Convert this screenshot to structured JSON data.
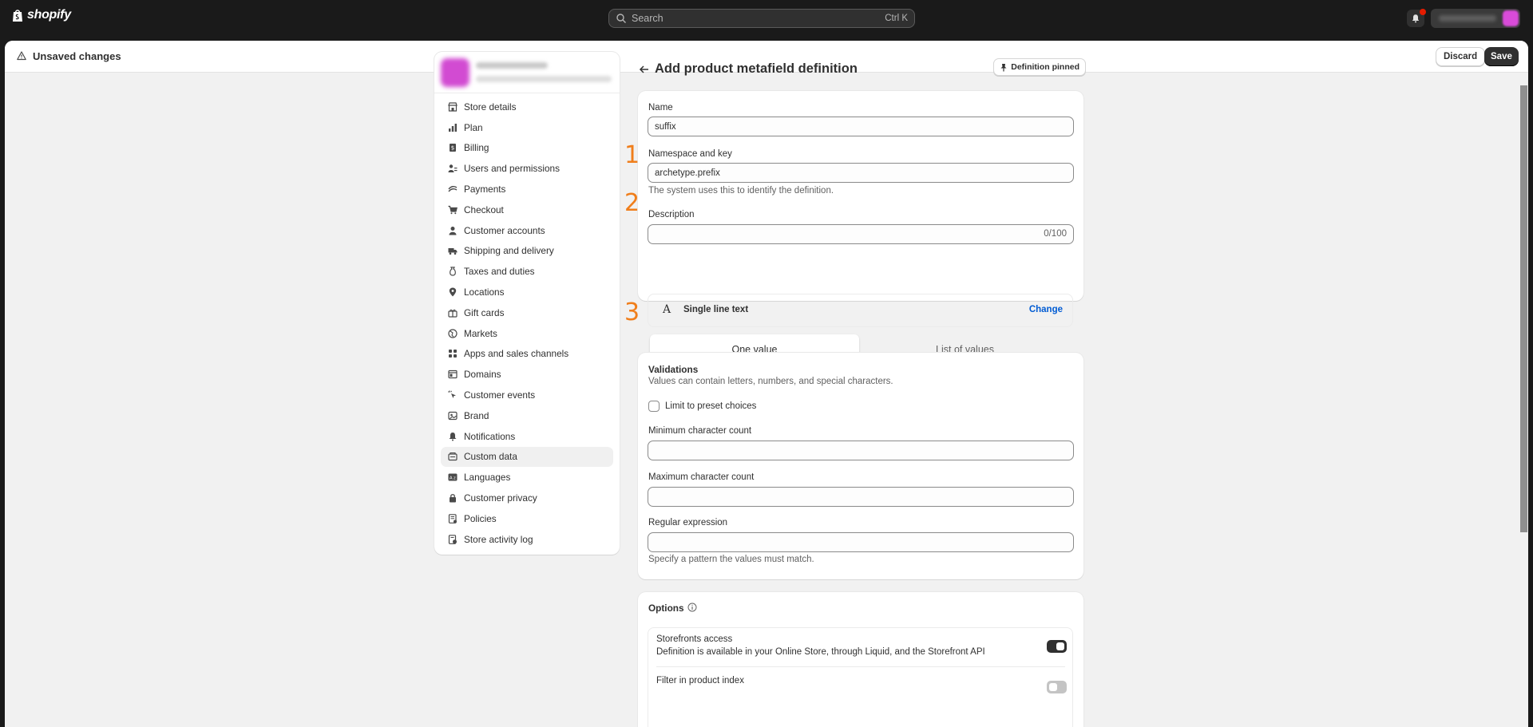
{
  "topbar": {
    "brand": "shopify",
    "search_placeholder": "Search",
    "search_shortcut": "Ctrl K"
  },
  "savebar": {
    "status": "Unsaved changes",
    "discard_label": "Discard",
    "save_label": "Save"
  },
  "sidebar": {
    "items": [
      {
        "label": "Store details",
        "icon": "store-icon"
      },
      {
        "label": "Plan",
        "icon": "plan-icon"
      },
      {
        "label": "Billing",
        "icon": "billing-icon"
      },
      {
        "label": "Users and permissions",
        "icon": "users-icon"
      },
      {
        "label": "Payments",
        "icon": "payments-icon"
      },
      {
        "label": "Checkout",
        "icon": "cart-icon"
      },
      {
        "label": "Customer accounts",
        "icon": "person-icon"
      },
      {
        "label": "Shipping and delivery",
        "icon": "truck-icon"
      },
      {
        "label": "Taxes and duties",
        "icon": "tax-icon"
      },
      {
        "label": "Locations",
        "icon": "location-icon"
      },
      {
        "label": "Gift cards",
        "icon": "gift-icon"
      },
      {
        "label": "Markets",
        "icon": "globe-icon"
      },
      {
        "label": "Apps and sales channels",
        "icon": "apps-icon"
      },
      {
        "label": "Domains",
        "icon": "domains-icon"
      },
      {
        "label": "Customer events",
        "icon": "cursor-icon"
      },
      {
        "label": "Brand",
        "icon": "brand-icon"
      },
      {
        "label": "Notifications",
        "icon": "bell-icon"
      },
      {
        "label": "Custom data",
        "icon": "custom-data-icon",
        "active": true
      },
      {
        "label": "Languages",
        "icon": "languages-icon"
      },
      {
        "label": "Customer privacy",
        "icon": "lock-icon"
      },
      {
        "label": "Policies",
        "icon": "policies-icon"
      },
      {
        "label": "Store activity log",
        "icon": "activity-icon"
      }
    ]
  },
  "page": {
    "title": "Add product metafield definition",
    "pin_label": "Definition pinned"
  },
  "definition": {
    "name_label": "Name",
    "name_value": "suffix",
    "namespace_label": "Namespace and key",
    "namespace_value": "archetype.prefix",
    "namespace_help": "The system uses this to identify the definition.",
    "description_label": "Description",
    "description_counter": "0/100",
    "type_glyph": "A",
    "type_label": "Single line text",
    "change_label": "Change",
    "one_value_label": "One value",
    "list_values_label": "List of values"
  },
  "annotations": [
    "1",
    "2",
    "3"
  ],
  "validations": {
    "title": "Validations",
    "subtitle": "Values can contain letters, numbers, and special characters.",
    "preset_label": "Limit to preset choices",
    "min_label": "Minimum character count",
    "max_label": "Maximum character count",
    "regex_label": "Regular expression",
    "regex_help": "Specify a pattern the values must match."
  },
  "options": {
    "title": "Options",
    "storefront_title": "Storefronts access",
    "storefront_desc": "Definition is available in your Online Store, through Liquid, and the Storefront API",
    "storefront_on": true,
    "filter_title": "Filter in product index",
    "filter_on": false
  },
  "colors": {
    "annotation": "#f07e1b",
    "link": "#005bd3",
    "primary": "#303030"
  }
}
